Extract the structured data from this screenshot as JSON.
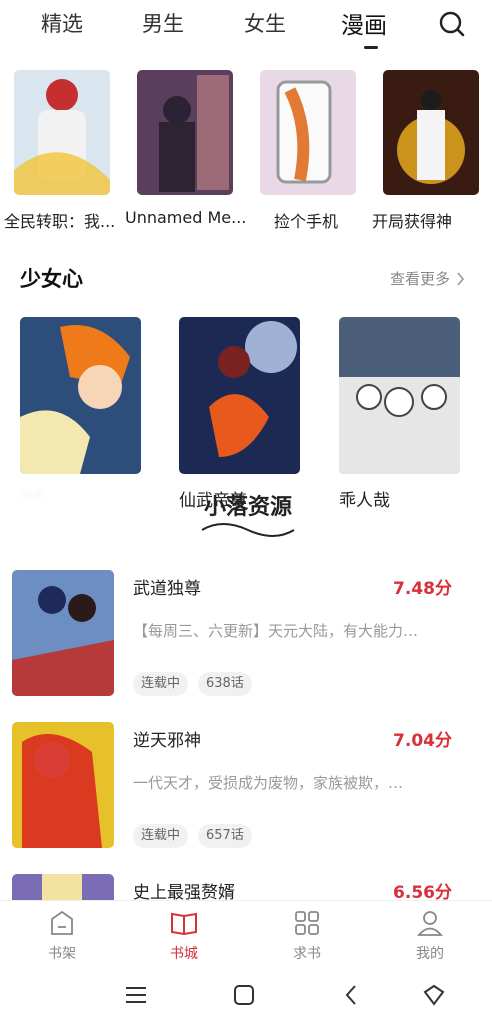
{
  "top_tabs": [
    {
      "label": "精选"
    },
    {
      "label": "男生"
    },
    {
      "label": "女生"
    },
    {
      "label": "漫画"
    }
  ],
  "active_tab": "漫画",
  "row1": [
    {
      "title": "全民转职：我..."
    },
    {
      "title": "Unnamed Me..."
    },
    {
      "title": "捡个手机"
    },
    {
      "title": "开局获得神"
    }
  ],
  "section": {
    "title": "少女心",
    "see_more": "查看更多"
  },
  "row2": [
    {
      "title": "·  ·"
    },
    {
      "title": "仙武帝尊"
    },
    {
      "title": "乖人哉"
    }
  ],
  "watermark": {
    "text": "小落资源"
  },
  "list": [
    {
      "title": "武道独尊",
      "score": "7.48分",
      "desc": "【每周三、六更新】天元大陆，有大能力…",
      "status": "连载中",
      "chapters": "638话"
    },
    {
      "title": "逆天邪神",
      "score": "7.04分",
      "desc": "一代天才，受损成为废物，家族被欺，…",
      "status": "连载中",
      "chapters": "657话"
    },
    {
      "title": "史上最强赘婿",
      "score": "6.56分"
    }
  ],
  "bottom_nav": [
    {
      "label": "书架",
      "icon": "bookshelf-icon"
    },
    {
      "label": "书城",
      "icon": "book-open-icon"
    },
    {
      "label": "求书",
      "icon": "grid-icon"
    },
    {
      "label": "我的",
      "icon": "person-icon"
    }
  ],
  "colors": {
    "accent": "#d7303a",
    "text": "#222222",
    "muted": "#999999"
  }
}
